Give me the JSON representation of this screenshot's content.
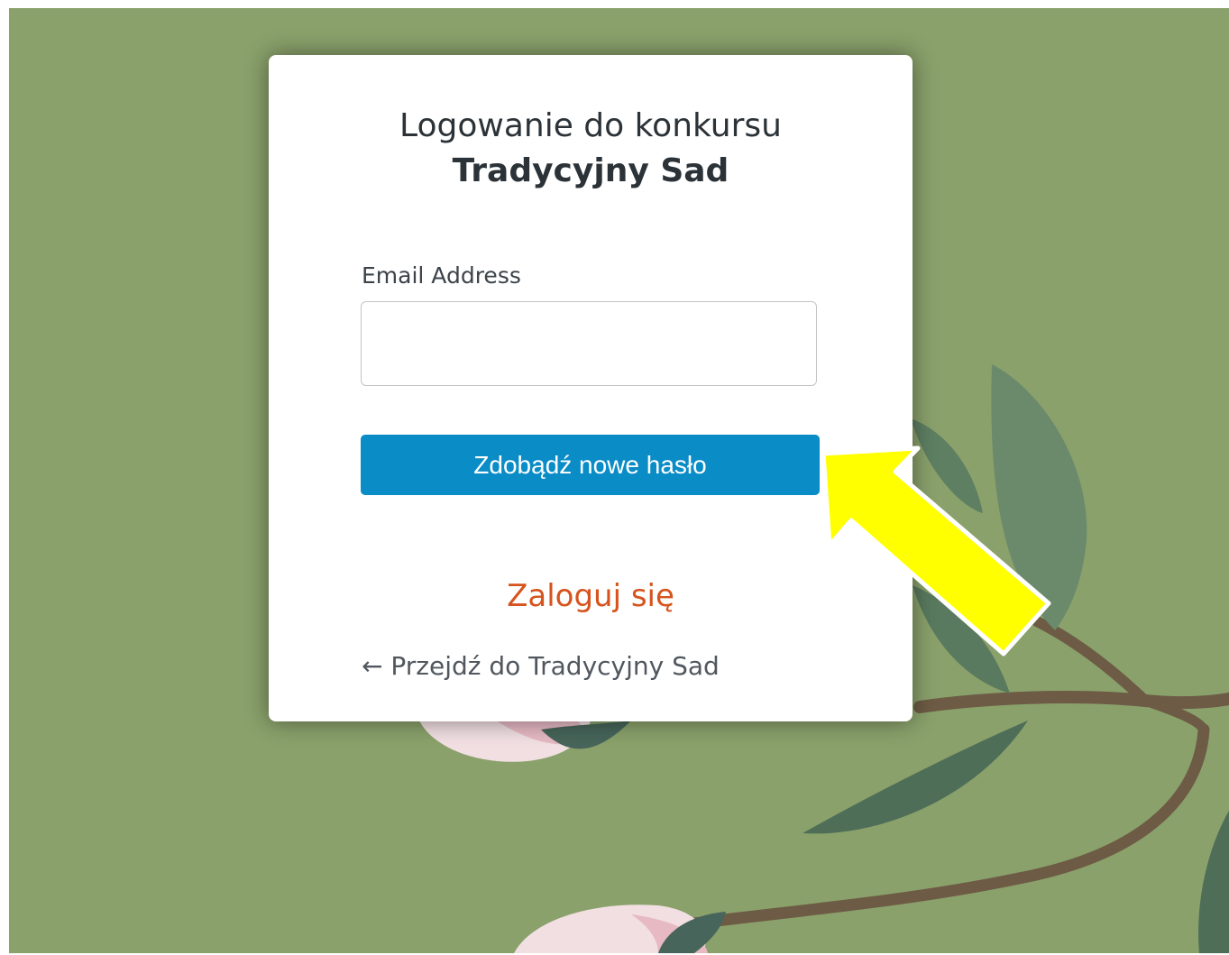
{
  "login": {
    "title_line1": "Logowanie do konkursu",
    "title_line2": "Tradycyjny Sad",
    "email_label": "Email Address",
    "email_value": "",
    "submit_label": "Zdobądź nowe hasło",
    "login_link": "Zaloguj się",
    "back_link": "← Przejdź do Tradycyjny Sad"
  },
  "colors": {
    "background": "#8aa16b",
    "button": "#0a8cc7",
    "link_accent": "#d6531d",
    "annotation_arrow": "#ffff00"
  },
  "icons": {
    "annotation": "arrow-pointer-icon"
  }
}
